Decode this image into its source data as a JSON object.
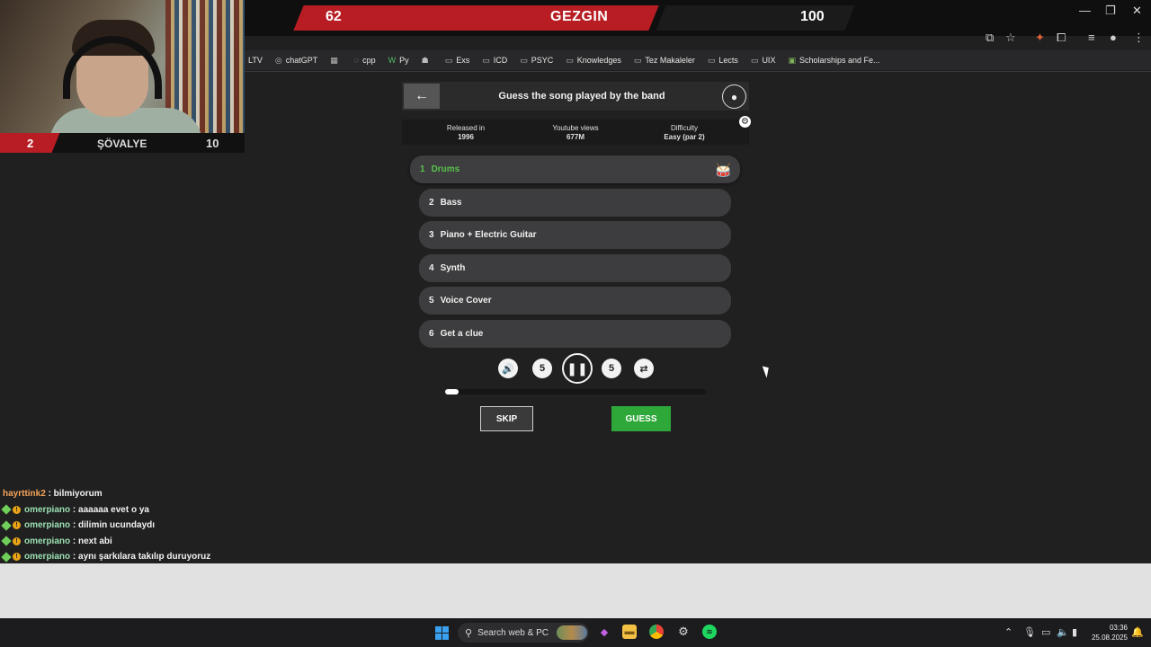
{
  "overlay": {
    "top_left_score": "62",
    "top_title": "GEZGIN",
    "top_right_score": "100",
    "cam_left_score": "2",
    "cam_title": "ŞÖVALYE",
    "cam_right_score": "10"
  },
  "window_controls": {
    "minimize": "—",
    "restore": "❐",
    "close": "✕"
  },
  "bookmarks": [
    {
      "icon": "",
      "label": "LTV"
    },
    {
      "icon": "◎",
      "label": "chatGPT"
    },
    {
      "icon": "▦",
      "label": ""
    },
    {
      "icon": "◌",
      "label": "cpp"
    },
    {
      "icon": "W",
      "label": "Py"
    },
    {
      "icon": "☗",
      "label": ""
    },
    {
      "icon": "▭",
      "label": "Exs"
    },
    {
      "icon": "▭",
      "label": "ICD"
    },
    {
      "icon": "▭",
      "label": "PSYC"
    },
    {
      "icon": "▭",
      "label": "Knowledges"
    },
    {
      "icon": "▭",
      "label": "Tez Makaleler"
    },
    {
      "icon": "▭",
      "label": "Lects"
    },
    {
      "icon": "▭",
      "label": "UIX"
    },
    {
      "icon": "▣",
      "label": "Scholarships and Fe..."
    }
  ],
  "game": {
    "title": "Guess the song played by the band",
    "info": [
      {
        "label": "Released in",
        "value": "1996"
      },
      {
        "label": "Youtube views",
        "value": "677M"
      },
      {
        "label": "Difficulty",
        "value": "Easy (par 2)"
      }
    ],
    "tracks": [
      {
        "num": "1",
        "label": "Drums"
      },
      {
        "num": "2",
        "label": "Bass"
      },
      {
        "num": "3",
        "label": "Piano + Electric Guitar"
      },
      {
        "num": "4",
        "label": "Synth"
      },
      {
        "num": "5",
        "label": "Voice Cover"
      },
      {
        "num": "6",
        "label": "Get a clue"
      }
    ],
    "active_track": 1,
    "rewind_label": "5",
    "forward_label": "5",
    "progress_fraction": 0.05,
    "skip_label": "SKIP",
    "guess_label": "GUESS"
  },
  "chat": [
    {
      "user": "hayrttink2",
      "message": ": bilmiyorum",
      "badges": false
    },
    {
      "user": "omerpiano",
      "message": ": aaaaaa evet o ya",
      "badges": true
    },
    {
      "user": "omerpiano",
      "message": ": dilimin ucundaydı",
      "badges": true
    },
    {
      "user": "omerpiano",
      "message": ": next abi",
      "badges": true
    },
    {
      "user": "omerpiano",
      "message": ": aynı şarkılara takılıp duruyoruz",
      "badges": true
    }
  ],
  "taskbar": {
    "search_placeholder": "Search web & PC",
    "time": "03:36",
    "date": "25.08.2025"
  },
  "colors": {
    "accent_red": "#b81d24",
    "active_green": "#57c24a",
    "guess_green": "#2fa83a"
  }
}
